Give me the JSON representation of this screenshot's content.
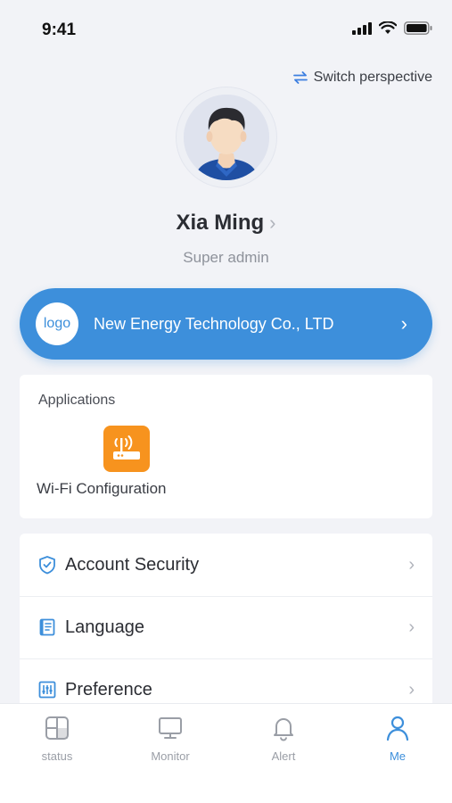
{
  "status_bar": {
    "time": "9:41"
  },
  "header": {
    "switch_label": "Switch perspective"
  },
  "profile": {
    "name": "Xia Ming",
    "role": "Super admin"
  },
  "company": {
    "logo_text": "logo",
    "name": "New Energy Technology Co., LTD"
  },
  "applications": {
    "title": "Applications",
    "items": [
      {
        "label": "Wi-Fi Configuration",
        "icon": "wifi-router-icon"
      }
    ]
  },
  "menu": {
    "items": [
      {
        "label": "Account Security",
        "icon": "shield-check-icon"
      },
      {
        "label": "Language",
        "icon": "book-icon"
      },
      {
        "label": "Preference",
        "icon": "sliders-icon"
      }
    ]
  },
  "tabs": [
    {
      "label": "status",
      "icon": "dashboard-icon"
    },
    {
      "label": "Monitor",
      "icon": "monitor-icon"
    },
    {
      "label": "Alert",
      "icon": "bell-icon"
    },
    {
      "label": "Me",
      "icon": "person-icon",
      "active": true
    }
  ],
  "colors": {
    "accent": "#3d8fdb",
    "app_orange": "#f7931e",
    "background": "#f2f3f7"
  }
}
